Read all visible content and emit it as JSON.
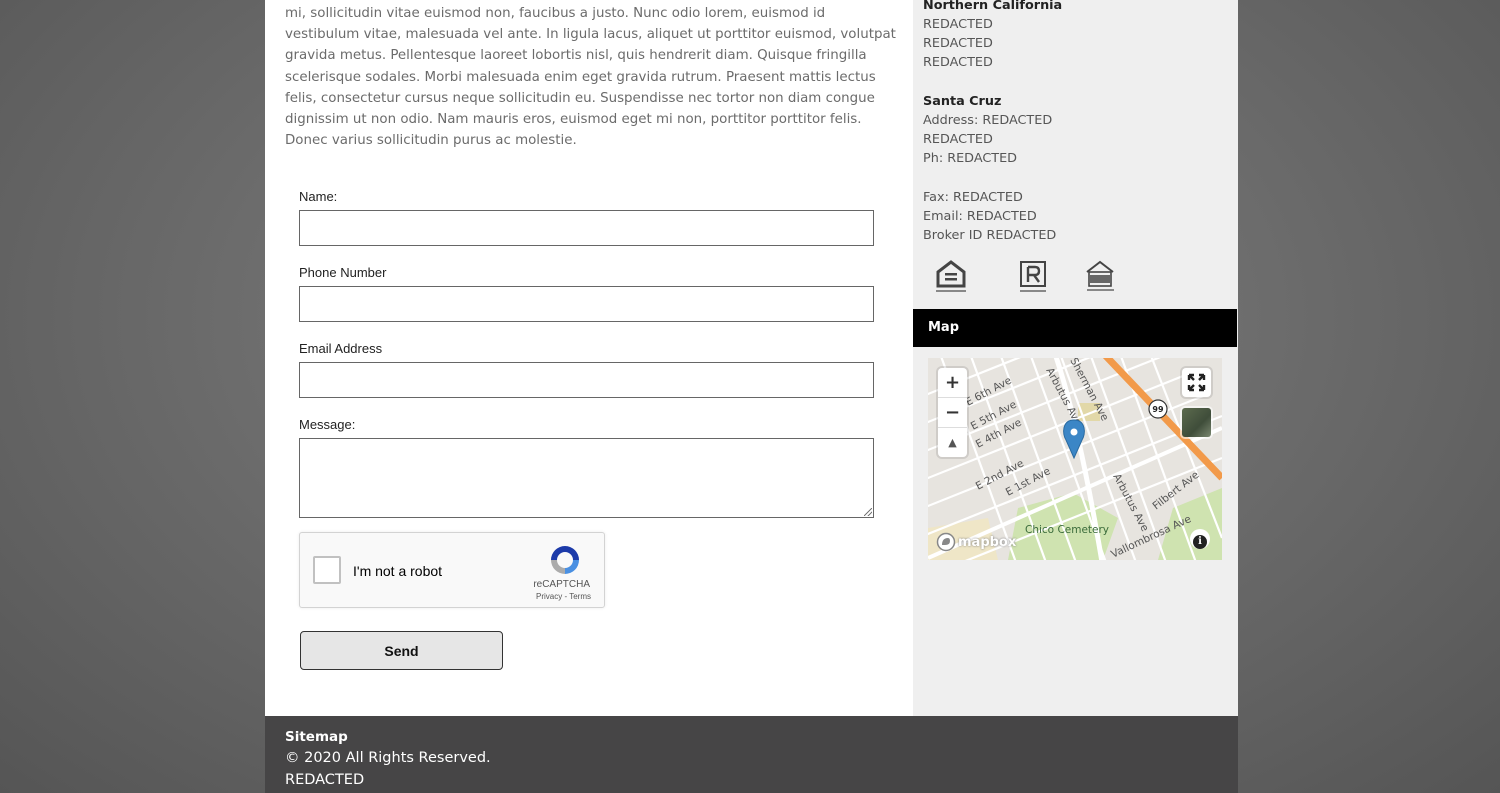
{
  "intro_text": "mi, sollicitudin vitae euismod non, faucibus a justo. Nunc odio lorem, euismod id vestibulum vitae, malesuada vel ante. In ligula lacus, aliquet ut porttitor euismod, volutpat gravida metus. Pellentesque laoreet lobortis nisl, quis hendrerit diam. Quisque fringilla scelerisque sodales. Morbi malesuada enim eget gravida rutrum. Praesent mattis lectus felis, consectetur cursus neque sollicitudin eu. Suspendisse nec tortor non diam congue dignissim ut non odio. Nam mauris eros, euismod eget mi non, porttitor porttitor felis. Donec varius sollicitudin purus ac molestie.",
  "form": {
    "name_label": "Name:",
    "name_value": "",
    "phone_label": "Phone Number",
    "phone_value": "",
    "email_label": "Email Address",
    "email_value": "",
    "message_label": "Message:",
    "message_value": "",
    "captcha_label": "I'm not a robot",
    "captcha_brand": "reCAPTCHA",
    "captcha_links": "Privacy - Terms",
    "send_label": "Send"
  },
  "sidebar": {
    "office1_title": "Northern California",
    "office1_lines": [
      "REDACTED",
      "REDACTED",
      "REDACTED"
    ],
    "office2_title": "Santa Cruz",
    "office2_address": "Address: REDACTED",
    "office2_line2": "REDACTED",
    "office2_phone": "Ph: REDACTED",
    "fax": "Fax: REDACTED",
    "email": "Email: REDACTED",
    "broker": "Broker ID REDACTED",
    "logos": [
      "equal-housing-opportunity-logo",
      "realtor-logo",
      "narpm-logo"
    ],
    "map_title": "Map"
  },
  "map": {
    "zoom_in": "+",
    "zoom_out": "−",
    "compass": "▲",
    "info": "i",
    "attribution": "mapbox",
    "route_shield": "99",
    "streets": [
      "E 6th Ave",
      "E 5th Ave",
      "E 4th Ave",
      "E 2nd Ave",
      "E 1st Ave",
      "Arbutus Ave",
      "Arbutus Ave",
      "Filbert Ave",
      "Sherman Ave",
      "Vallombrosa Ave",
      "Chico Cemetery"
    ]
  },
  "footer": {
    "sitemap": "Sitemap",
    "copyright": "© 2020 All Rights Reserved.",
    "company": "REDACTED"
  },
  "colors": {
    "footer_bg": "#464546",
    "sidebar_bg": "#efefef",
    "map_header_bg": "#000000",
    "pin": "#3b86c6",
    "highway": "#f29a4a"
  }
}
